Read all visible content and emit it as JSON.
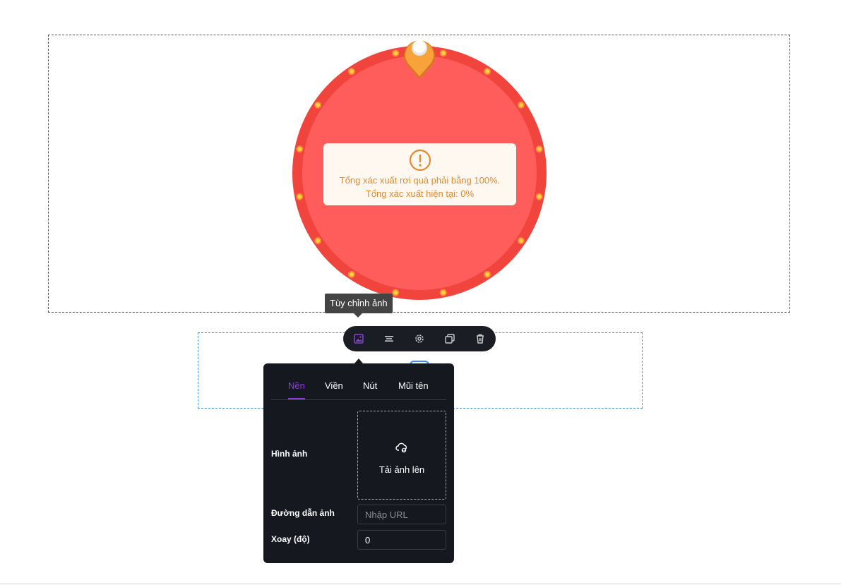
{
  "warning": {
    "line1": "Tổng xác xuất rơi quà phải bằng 100%.",
    "line2": "Tổng xác xuất hiện tại: 0%",
    "icon": "exclamation-circle-icon"
  },
  "wheel": {
    "rim_color": "#f0443c",
    "face_color": "#ff5c5c",
    "pointer_color": "#f8a23a",
    "light_color": "#ffd52e"
  },
  "tooltip": {
    "label": "Tùy chỉnh ảnh"
  },
  "toolbar": {
    "items": [
      "image-icon",
      "align-center-icon",
      "gear-icon",
      "copy-icon",
      "trash-icon"
    ],
    "active_color": "#8b3fd9"
  },
  "panel": {
    "tabs": [
      "Nền",
      "Viền",
      "Nút",
      "Mũi tên"
    ],
    "active_tab": "Nền",
    "image_label": "Hình ảnh",
    "upload_label": "Tải ảnh lên",
    "url_label": "Đường dẫn ảnh",
    "url_placeholder": "Nhập URL",
    "url_value": "",
    "rotate_label": "Xoay (độ)",
    "rotate_value": "0"
  }
}
